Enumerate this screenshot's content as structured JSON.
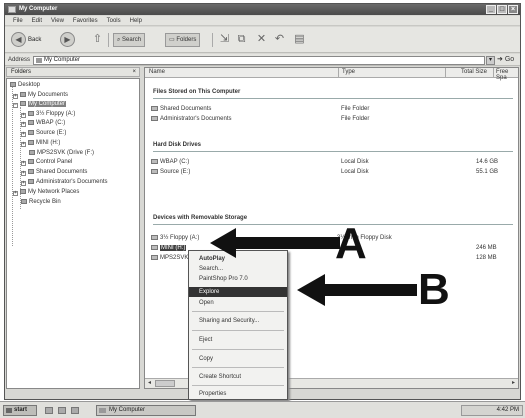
{
  "window": {
    "title": "My Computer"
  },
  "menu": [
    "File",
    "Edit",
    "View",
    "Favorites",
    "Tools",
    "Help"
  ],
  "toolbar": {
    "back_label": "Back",
    "search_label": "Search",
    "folders_label": "Folders"
  },
  "address": {
    "label": "Address",
    "value": "My Computer",
    "go_label": "Go"
  },
  "folders_pane": {
    "title": "Folders",
    "close_glyph": "×",
    "items": [
      {
        "label": "Desktop"
      },
      {
        "label": "My Documents"
      },
      {
        "label": "My Computer"
      },
      {
        "label": "3½ Floppy (A:)"
      },
      {
        "label": "WBAP (C:)"
      },
      {
        "label": "Source (E:)"
      },
      {
        "label": "MINI (H:)"
      },
      {
        "label": "MPS2SVK (Drive (F:)"
      },
      {
        "label": "Control Panel"
      },
      {
        "label": "Shared Documents"
      },
      {
        "label": "Administrator's Documents"
      },
      {
        "label": "My Network Places"
      },
      {
        "label": "Recycle Bin"
      }
    ]
  },
  "columns": {
    "name": "Name",
    "type": "Type",
    "total_size": "Total Size",
    "free": "Free Spa"
  },
  "groups": {
    "files": "Files Stored on This Computer",
    "hdd": "Hard Disk Drives",
    "removable": "Devices with Removable Storage"
  },
  "rows": {
    "shared_docs": {
      "name": "Shared Documents",
      "type": "File Folder",
      "size": ""
    },
    "admin_docs": {
      "name": "Administrator's Documents",
      "type": "File Folder",
      "size": ""
    },
    "wbap": {
      "name": "WBAP (C:)",
      "type": "Local Disk",
      "size": "14.6 GB"
    },
    "source": {
      "name": "Source (E:)",
      "type": "Local Disk",
      "size": "55.1 GB"
    },
    "floppy": {
      "name": "3½ Floppy (A:)",
      "type": "3½-Inch Floppy Disk",
      "size": ""
    },
    "mini": {
      "name": "MINI (H:)",
      "type": "",
      "size": "246 MB"
    },
    "mps": {
      "name": "MPS2SVK (F:)",
      "type": "",
      "size": "128 MB"
    }
  },
  "context_menu": [
    {
      "label": "AutoPlay",
      "bold": true
    },
    {
      "label": "Search..."
    },
    {
      "label": "PaintShop Pro 7.0"
    },
    {
      "label": "Explore",
      "highlighted": true
    },
    {
      "label": "Open"
    },
    {
      "label": "Sharing and Security..."
    },
    {
      "label": "Eject"
    },
    {
      "label": "Copy"
    },
    {
      "label": "Create Shortcut"
    },
    {
      "label": "Properties"
    }
  ],
  "callouts": {
    "a": "A",
    "b": "B"
  },
  "taskbar": {
    "start_label": "start",
    "task_label": "My Computer",
    "clock": "4:42 PM"
  }
}
